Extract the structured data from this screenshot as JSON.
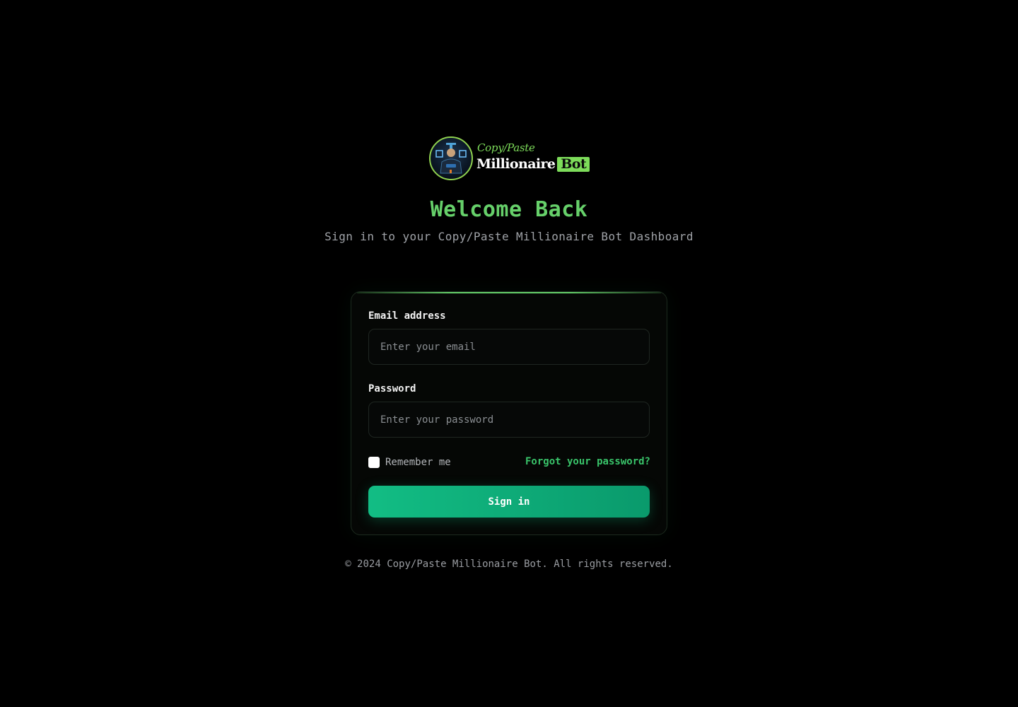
{
  "brand": {
    "script_text": "Copy/Paste",
    "main_text": "Millionaire",
    "badge_text": "Bot",
    "accent_color": "#7ddc5a"
  },
  "header": {
    "title": "Welcome Back",
    "subtitle": "Sign in to your Copy/Paste Millionaire Bot Dashboard"
  },
  "form": {
    "email_label": "Email address",
    "email_placeholder": "Enter your email",
    "email_value": "",
    "password_label": "Password",
    "password_placeholder": "Enter your password",
    "password_value": "",
    "remember_label": "Remember me",
    "remember_checked": false,
    "forgot_label": "Forgot your password?",
    "submit_label": "Sign in",
    "submit_color": "#10b981"
  },
  "footer": {
    "copyright": "© 2024 Copy/Paste Millionaire Bot. All rights reserved."
  },
  "icons": {
    "logo": "robot-avatar-icon"
  }
}
